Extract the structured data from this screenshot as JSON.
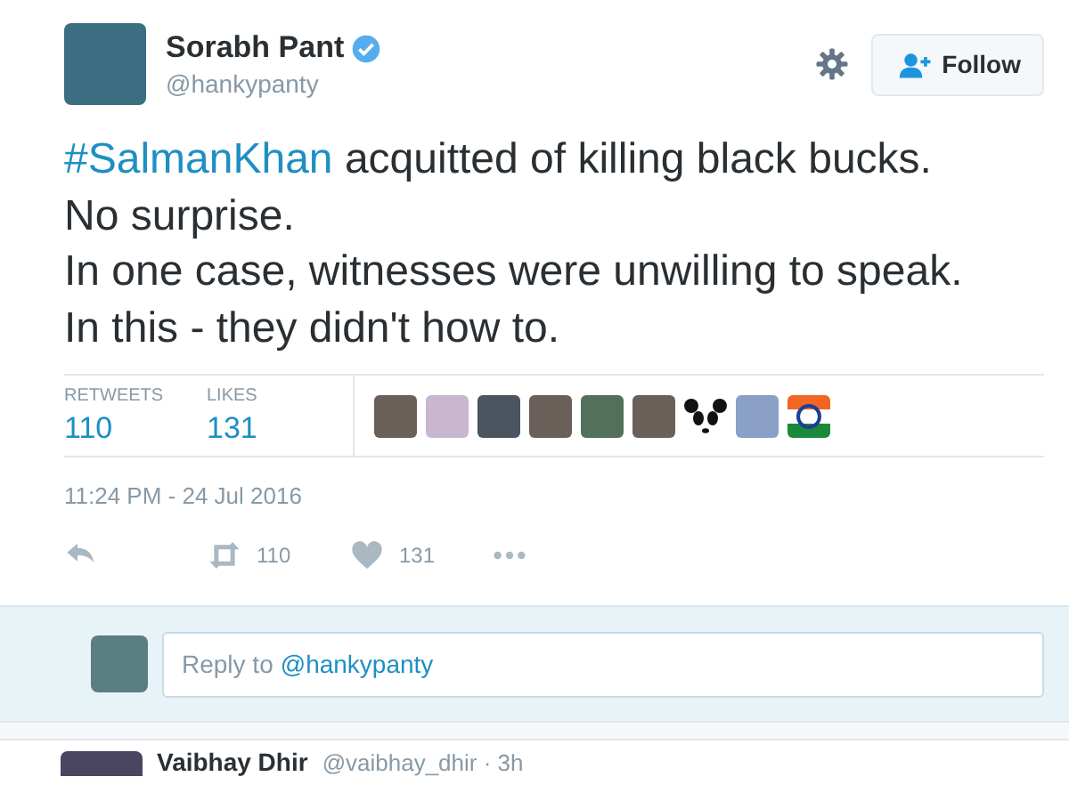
{
  "author": {
    "name": "Sorabh Pant",
    "handle": "@hankypanty",
    "verified": true
  },
  "follow_button": {
    "label": "Follow"
  },
  "tweet": {
    "hashtag": "#SalmanKhan",
    "lines": [
      " acquitted of killing black bucks.",
      "No surprise.",
      "In one case, witnesses were unwilling to speak.",
      "In this - they didn't how to."
    ]
  },
  "stats": [
    {
      "label": "RETWEETS",
      "value": "110"
    },
    {
      "label": "LIKES",
      "value": "131"
    }
  ],
  "likers": [
    {
      "kind": "photo"
    },
    {
      "kind": "photo"
    },
    {
      "kind": "photo"
    },
    {
      "kind": "photo"
    },
    {
      "kind": "photo"
    },
    {
      "kind": "photo"
    },
    {
      "kind": "panda"
    },
    {
      "kind": "photo"
    },
    {
      "kind": "flag"
    }
  ],
  "timestamp": "11:24 PM - 24 Jul 2016",
  "actions": [
    {
      "kind": "reply"
    },
    {
      "kind": "retweet",
      "count": "110"
    },
    {
      "kind": "like",
      "count": "131"
    },
    {
      "kind": "more"
    }
  ],
  "reply_box": {
    "placeholder": "Reply to",
    "mention": "@hankypanty"
  },
  "next_reply": {
    "name": "Vaibhay Dhir",
    "meta": "@vaibhay_dhir · 3h"
  }
}
